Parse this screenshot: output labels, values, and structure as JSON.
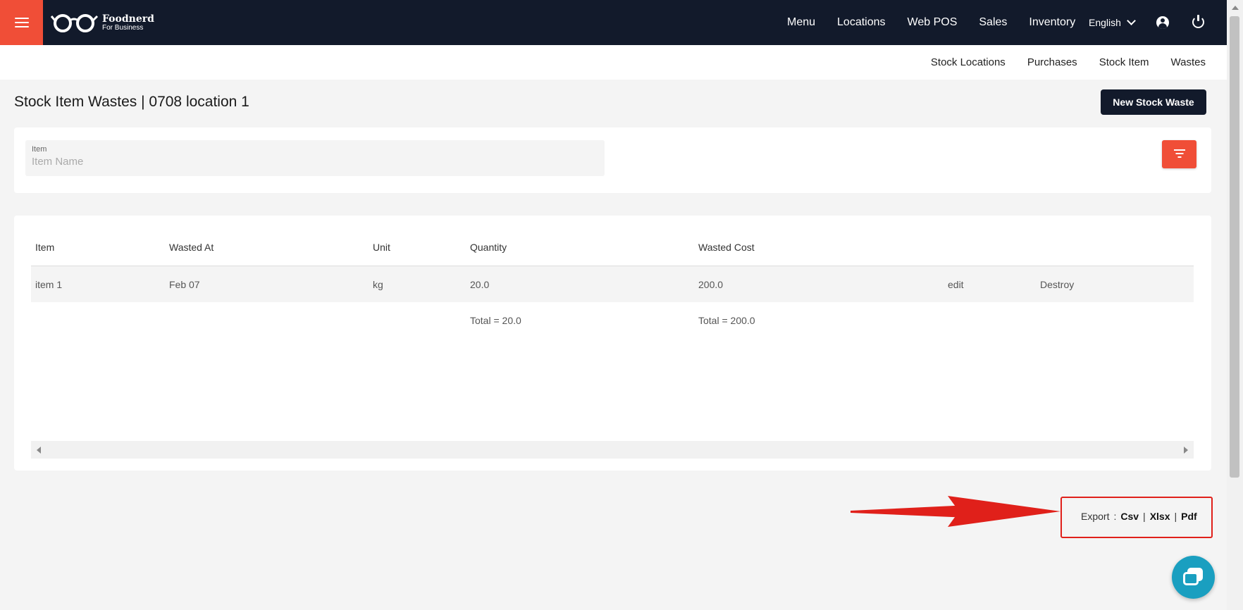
{
  "brand": {
    "name": "Foodnerd",
    "tagline": "For Business"
  },
  "topnav": {
    "items": [
      "Menu",
      "Locations",
      "Web POS",
      "Sales",
      "Inventory"
    ],
    "language": "English"
  },
  "subnav": {
    "items": [
      "Stock Locations",
      "Purchases",
      "Stock Item",
      "Wastes"
    ]
  },
  "page": {
    "title": "Stock Item Wastes | 0708 location 1",
    "new_button": "New Stock Waste"
  },
  "filter": {
    "item_label": "Item",
    "item_placeholder": "Item Name",
    "item_value": ""
  },
  "table": {
    "headers": [
      "Item",
      "Wasted At",
      "Unit",
      "Quantity",
      "Wasted Cost"
    ],
    "rows": [
      {
        "item": "item 1",
        "wasted_at": "Feb 07",
        "unit": "kg",
        "quantity": "20.0",
        "wasted_cost": "200.0",
        "edit": "edit",
        "destroy": "Destroy"
      }
    ],
    "totals": {
      "quantity": "Total = 20.0",
      "wasted_cost": "Total = 200.0"
    }
  },
  "export": {
    "label": "Export",
    "colon": ":",
    "csv": "Csv",
    "xlsx": "Xlsx",
    "pdf": "Pdf",
    "sep": "|"
  },
  "colors": {
    "navbar": "#121a2b",
    "accent": "#f04e37",
    "annotation": "#e0201a",
    "chat": "#1a9fc0"
  }
}
